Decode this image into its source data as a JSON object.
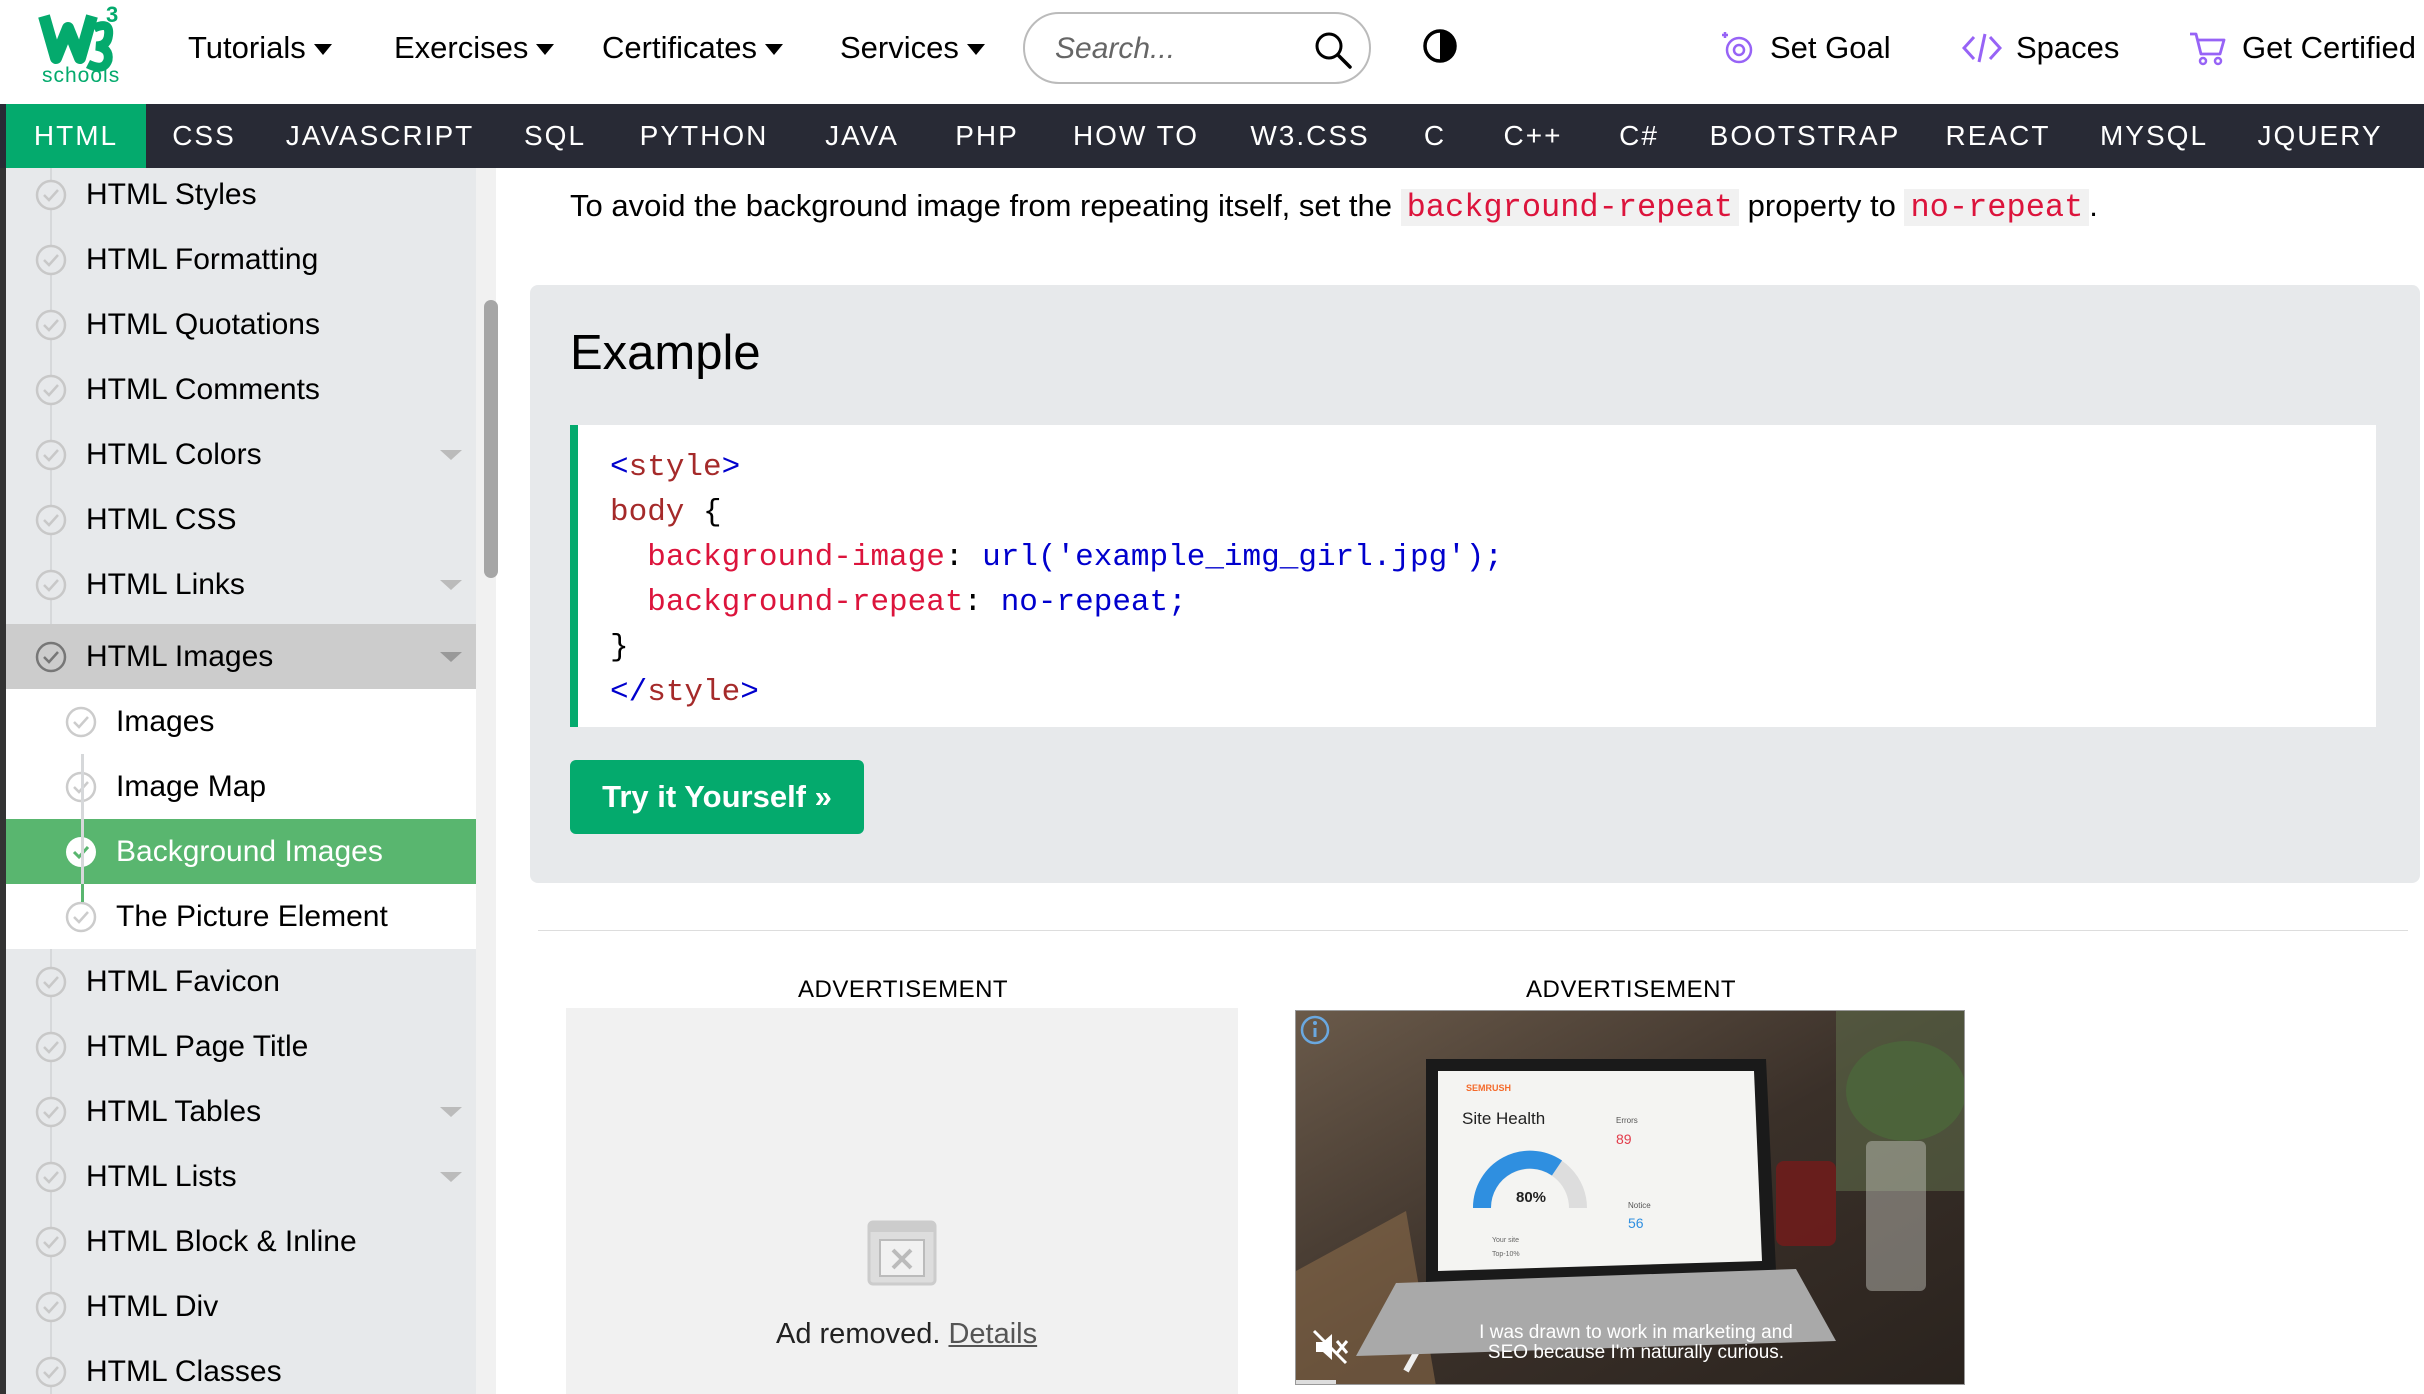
{
  "logo": {
    "text": "schools",
    "superscript": "3"
  },
  "nav": {
    "items": [
      "Tutorials",
      "Exercises",
      "Certificates",
      "Services"
    ],
    "search_placeholder": "Search...",
    "right": [
      "Set Goal",
      "Spaces",
      "Get Certified"
    ]
  },
  "topics": [
    "HTML",
    "CSS",
    "JAVASCRIPT",
    "SQL",
    "PYTHON",
    "JAVA",
    "PHP",
    "HOW TO",
    "W3.CSS",
    "C",
    "C++",
    "C#",
    "BOOTSTRAP",
    "REACT",
    "MYSQL",
    "JQUERY"
  ],
  "sidebar": {
    "items": [
      "HTML Styles",
      "HTML Formatting",
      "HTML Quotations",
      "HTML Comments",
      "HTML Colors",
      "HTML CSS",
      "HTML Links",
      "HTML Images",
      "Images",
      "Image Map",
      "Background Images",
      "The Picture Element",
      "HTML Favicon",
      "HTML Page Title",
      "HTML Tables",
      "HTML Lists",
      "HTML Block & Inline",
      "HTML Div",
      "HTML Classes"
    ]
  },
  "main": {
    "intro_before": "To avoid the background image from repeating itself, set the ",
    "intro_kw1": "background-repeat",
    "intro_mid": " property to ",
    "intro_kw2": "no-repeat",
    "intro_after": ".",
    "example_title": "Example",
    "code": {
      "open_tag": "<style>",
      "selector": "body",
      "brace_open": "{",
      "prop1": "background-image",
      "val1": "url('example_img_girl.jpg');",
      "prop2": "background-repeat",
      "val2": "no-repeat;",
      "brace_close": "}",
      "close_tag": "</style>"
    },
    "try_button": "Try it Yourself »"
  },
  "ads": {
    "label": "ADVERTISEMENT",
    "removed_text": "Ad removed.",
    "details_link": "Details",
    "video": {
      "brand": "SEMRUSH",
      "card_title": "Site Health",
      "gauge": "80%",
      "errors_label": "Errors",
      "errors_value": "89",
      "notice_label": "Notice",
      "notice_value": "56",
      "legend1": "Your site",
      "legend2": "Top-10%",
      "caption_line1": "I was drawn to work in marketing and",
      "caption_line2": "SEO because I'm naturally curious."
    }
  },
  "colors": {
    "brand_green": "#04AA6D",
    "dark_bar": "#282A35",
    "active_sub": "#59B66F",
    "sidebar_bg": "#E7E9EB"
  }
}
